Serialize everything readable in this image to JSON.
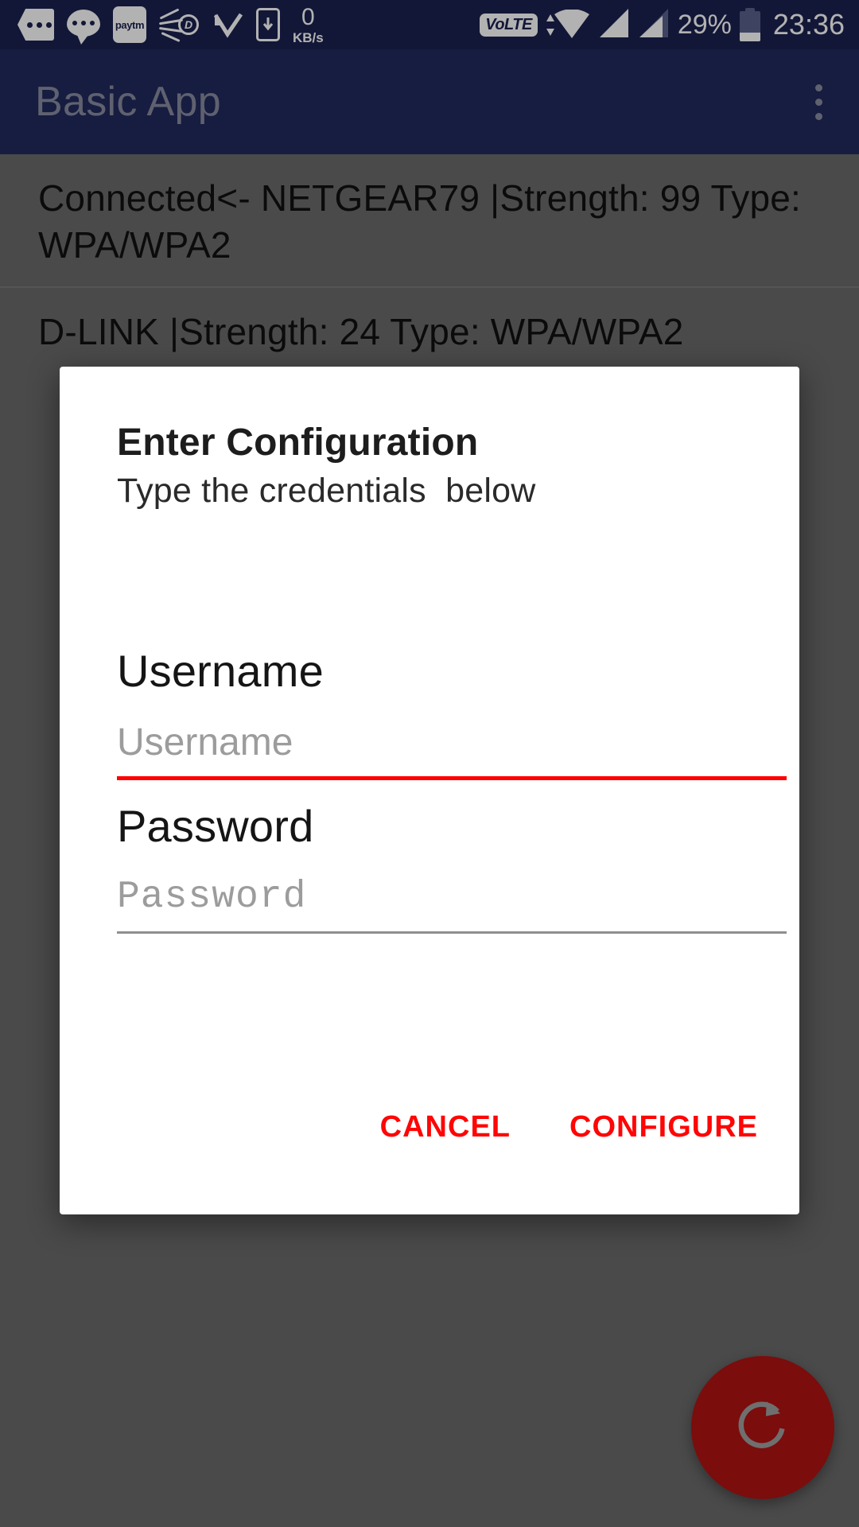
{
  "status_bar": {
    "background_color": "#1b2150",
    "network_speed_value": "0",
    "network_speed_unit": "KB/s",
    "volte_label": "VoLTE",
    "paytm_label": "paytm",
    "dubsmash_letter": "D",
    "battery_percent": "29%",
    "battery_level": 29,
    "clock": "23:36",
    "icons": [
      "tag-dots-icon",
      "speech-bubble-dots-icon",
      "paytm-icon",
      "dubsmash-icon",
      "arrow-check-icon",
      "download-phone-icon",
      "network-speed-icon",
      "volte-icon",
      "wifi-icon",
      "signal-sim1-icon",
      "signal-sim2-icon",
      "battery-icon"
    ]
  },
  "app_bar": {
    "title": "Basic App",
    "background_color": "#222a5e",
    "title_color": "#8a8ca0",
    "overflow_menu_label": "More options"
  },
  "wifi_list": [
    {
      "text": "Connected<- NETGEAR79 |Strength: 99 Type: WPA/WPA2"
    },
    {
      "text": "D-LINK |Strength: 24 Type: WPA/WPA2"
    }
  ],
  "dialog": {
    "title": "Enter Configuration",
    "subtitle": "Type the credentials  below",
    "username": {
      "label": "Username",
      "placeholder": "Username",
      "value": "",
      "underline_color": "#ff0000"
    },
    "password": {
      "label": "Password",
      "placeholder": "Password",
      "value": "",
      "underline_color": "#8f8f8f"
    },
    "cancel_label": "CANCEL",
    "configure_label": "CONFIGURE",
    "button_color": "#ff0505"
  },
  "fab": {
    "icon": "refresh-icon",
    "background_color": "#7b0d0d",
    "icon_color": "#6f6f6f"
  }
}
